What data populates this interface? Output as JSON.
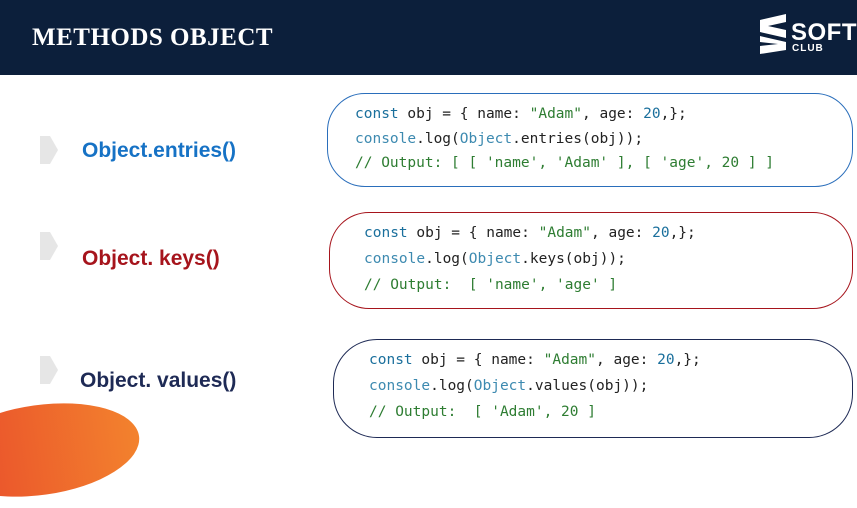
{
  "header": {
    "title": "METHODS OBJECT",
    "logo_main": "SOFT",
    "logo_sub": "CLUB"
  },
  "colors": {
    "header_bg": "#0c1f3b",
    "entries_blue": "#1672c5",
    "keys_red": "#a6141c",
    "values_navy": "#1e2a55",
    "accent_orange": "#f26a2c"
  },
  "methods": [
    {
      "label": "Object.entries()",
      "code": {
        "line1": {
          "kw": "const",
          "a": " obj = { name: ",
          "str": "\"Adam\"",
          "b": ", age: ",
          "num": "20",
          "c": ",};"
        },
        "line2": {
          "fn1": "console",
          "a": ".log(",
          "fn2": "Object",
          "b": ".entries(obj));"
        },
        "line3": "// Output: [ [ 'name', 'Adam' ], [ 'age', 20 ] ]"
      }
    },
    {
      "label": "Object. keys()",
      "code": {
        "line1": {
          "kw": "const",
          "a": " obj = { name: ",
          "str": "\"Adam\"",
          "b": ", age: ",
          "num": "20",
          "c": ",};"
        },
        "line2": {
          "fn1": "console",
          "a": ".log(",
          "fn2": "Object",
          "b": ".keys(obj));"
        },
        "line3": "// Output:  [ 'name', 'age' ]"
      }
    },
    {
      "label": "Object. values()",
      "code": {
        "line1": {
          "kw": "const",
          "a": " obj = { name: ",
          "str": "\"Adam\"",
          "b": ", age: ",
          "num": "20",
          "c": ",};"
        },
        "line2": {
          "fn1": "console",
          "a": ".log(",
          "fn2": "Object",
          "b": ".values(obj));"
        },
        "line3": "// Output:  [ 'Adam', 20 ]"
      }
    }
  ]
}
